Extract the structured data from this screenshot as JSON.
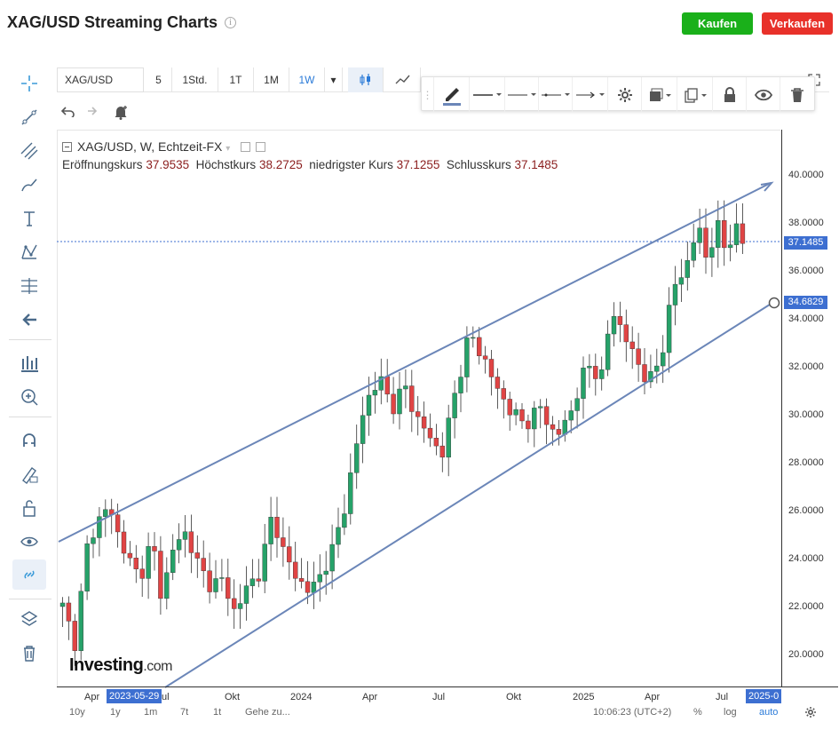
{
  "page": {
    "title": "XAG/USD Streaming Charts"
  },
  "header": {
    "buy_label": "Kaufen",
    "sell_label": "Verkaufen"
  },
  "topbar": {
    "symbol": "XAG/USD",
    "intervals": [
      "5",
      "1Std.",
      "1T",
      "1M",
      "1W"
    ],
    "selected_interval": "1W"
  },
  "legend": {
    "title": "XAG/USD, W, Echtzeit-FX",
    "open_label": "Eröffnungskurs",
    "open": "37.9535",
    "high_label": "Höchstkurs",
    "high": "38.2725",
    "low_label": "niedrigster Kurs",
    "low": "37.1255",
    "close_label": "Schlusskurs",
    "close": "37.1485"
  },
  "y_axis": {
    "ticks": [
      "40.0000",
      "38.0000",
      "36.0000",
      "34.0000",
      "32.0000",
      "30.0000",
      "28.0000",
      "26.0000",
      "24.0000",
      "22.0000",
      "20.0000"
    ],
    "current_price": "37.1485",
    "cursor_price": "34.6829"
  },
  "x_axis": {
    "ticks": [
      "Apr",
      "Jul",
      "Okt",
      "2024",
      "Apr",
      "Jul",
      "Okt",
      "2025",
      "Apr",
      "Jul"
    ],
    "left_date_badge": "2023-05-29",
    "right_date_badge": "2025-0",
    "partial_label": "ul"
  },
  "bottom_bar": {
    "ranges": [
      "10y",
      "1y",
      "1m",
      "7t",
      "1t"
    ],
    "goto": "Gehe zu...",
    "clock": "10:06:23 (UTC+2)",
    "percent": "%",
    "log": "log",
    "auto": "auto"
  },
  "logo": {
    "brand": "Investing",
    "suffix": ".com"
  },
  "colors": {
    "up": "#26a269",
    "down": "#e04444",
    "line": "#6b86b8",
    "accent": "#3d6fd1"
  }
}
